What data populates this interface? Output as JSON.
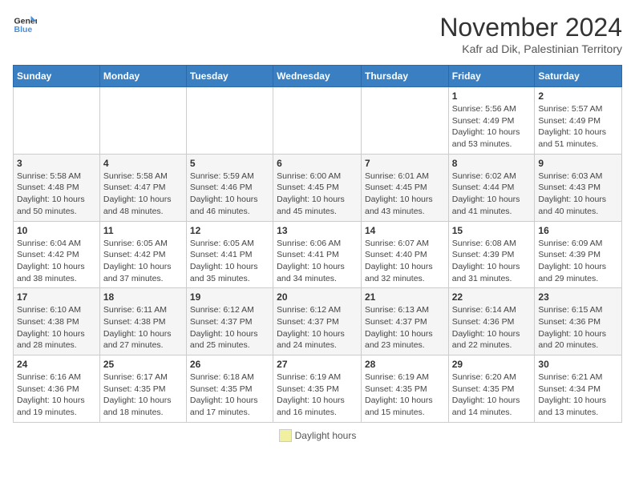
{
  "header": {
    "logo_line1": "General",
    "logo_line2": "Blue",
    "month": "November 2024",
    "location": "Kafr ad Dik, Palestinian Territory"
  },
  "footer": {
    "daylight_label": "Daylight hours"
  },
  "days_of_week": [
    "Sunday",
    "Monday",
    "Tuesday",
    "Wednesday",
    "Thursday",
    "Friday",
    "Saturday"
  ],
  "weeks": [
    {
      "days": [
        {
          "num": "",
          "info": ""
        },
        {
          "num": "",
          "info": ""
        },
        {
          "num": "",
          "info": ""
        },
        {
          "num": "",
          "info": ""
        },
        {
          "num": "",
          "info": ""
        },
        {
          "num": "1",
          "info": "Sunrise: 5:56 AM\nSunset: 4:49 PM\nDaylight: 10 hours and 53 minutes."
        },
        {
          "num": "2",
          "info": "Sunrise: 5:57 AM\nSunset: 4:49 PM\nDaylight: 10 hours and 51 minutes."
        }
      ]
    },
    {
      "days": [
        {
          "num": "3",
          "info": "Sunrise: 5:58 AM\nSunset: 4:48 PM\nDaylight: 10 hours and 50 minutes."
        },
        {
          "num": "4",
          "info": "Sunrise: 5:58 AM\nSunset: 4:47 PM\nDaylight: 10 hours and 48 minutes."
        },
        {
          "num": "5",
          "info": "Sunrise: 5:59 AM\nSunset: 4:46 PM\nDaylight: 10 hours and 46 minutes."
        },
        {
          "num": "6",
          "info": "Sunrise: 6:00 AM\nSunset: 4:45 PM\nDaylight: 10 hours and 45 minutes."
        },
        {
          "num": "7",
          "info": "Sunrise: 6:01 AM\nSunset: 4:45 PM\nDaylight: 10 hours and 43 minutes."
        },
        {
          "num": "8",
          "info": "Sunrise: 6:02 AM\nSunset: 4:44 PM\nDaylight: 10 hours and 41 minutes."
        },
        {
          "num": "9",
          "info": "Sunrise: 6:03 AM\nSunset: 4:43 PM\nDaylight: 10 hours and 40 minutes."
        }
      ]
    },
    {
      "days": [
        {
          "num": "10",
          "info": "Sunrise: 6:04 AM\nSunset: 4:42 PM\nDaylight: 10 hours and 38 minutes."
        },
        {
          "num": "11",
          "info": "Sunrise: 6:05 AM\nSunset: 4:42 PM\nDaylight: 10 hours and 37 minutes."
        },
        {
          "num": "12",
          "info": "Sunrise: 6:05 AM\nSunset: 4:41 PM\nDaylight: 10 hours and 35 minutes."
        },
        {
          "num": "13",
          "info": "Sunrise: 6:06 AM\nSunset: 4:41 PM\nDaylight: 10 hours and 34 minutes."
        },
        {
          "num": "14",
          "info": "Sunrise: 6:07 AM\nSunset: 4:40 PM\nDaylight: 10 hours and 32 minutes."
        },
        {
          "num": "15",
          "info": "Sunrise: 6:08 AM\nSunset: 4:39 PM\nDaylight: 10 hours and 31 minutes."
        },
        {
          "num": "16",
          "info": "Sunrise: 6:09 AM\nSunset: 4:39 PM\nDaylight: 10 hours and 29 minutes."
        }
      ]
    },
    {
      "days": [
        {
          "num": "17",
          "info": "Sunrise: 6:10 AM\nSunset: 4:38 PM\nDaylight: 10 hours and 28 minutes."
        },
        {
          "num": "18",
          "info": "Sunrise: 6:11 AM\nSunset: 4:38 PM\nDaylight: 10 hours and 27 minutes."
        },
        {
          "num": "19",
          "info": "Sunrise: 6:12 AM\nSunset: 4:37 PM\nDaylight: 10 hours and 25 minutes."
        },
        {
          "num": "20",
          "info": "Sunrise: 6:12 AM\nSunset: 4:37 PM\nDaylight: 10 hours and 24 minutes."
        },
        {
          "num": "21",
          "info": "Sunrise: 6:13 AM\nSunset: 4:37 PM\nDaylight: 10 hours and 23 minutes."
        },
        {
          "num": "22",
          "info": "Sunrise: 6:14 AM\nSunset: 4:36 PM\nDaylight: 10 hours and 22 minutes."
        },
        {
          "num": "23",
          "info": "Sunrise: 6:15 AM\nSunset: 4:36 PM\nDaylight: 10 hours and 20 minutes."
        }
      ]
    },
    {
      "days": [
        {
          "num": "24",
          "info": "Sunrise: 6:16 AM\nSunset: 4:36 PM\nDaylight: 10 hours and 19 minutes."
        },
        {
          "num": "25",
          "info": "Sunrise: 6:17 AM\nSunset: 4:35 PM\nDaylight: 10 hours and 18 minutes."
        },
        {
          "num": "26",
          "info": "Sunrise: 6:18 AM\nSunset: 4:35 PM\nDaylight: 10 hours and 17 minutes."
        },
        {
          "num": "27",
          "info": "Sunrise: 6:19 AM\nSunset: 4:35 PM\nDaylight: 10 hours and 16 minutes."
        },
        {
          "num": "28",
          "info": "Sunrise: 6:19 AM\nSunset: 4:35 PM\nDaylight: 10 hours and 15 minutes."
        },
        {
          "num": "29",
          "info": "Sunrise: 6:20 AM\nSunset: 4:35 PM\nDaylight: 10 hours and 14 minutes."
        },
        {
          "num": "30",
          "info": "Sunrise: 6:21 AM\nSunset: 4:34 PM\nDaylight: 10 hours and 13 minutes."
        }
      ]
    }
  ]
}
